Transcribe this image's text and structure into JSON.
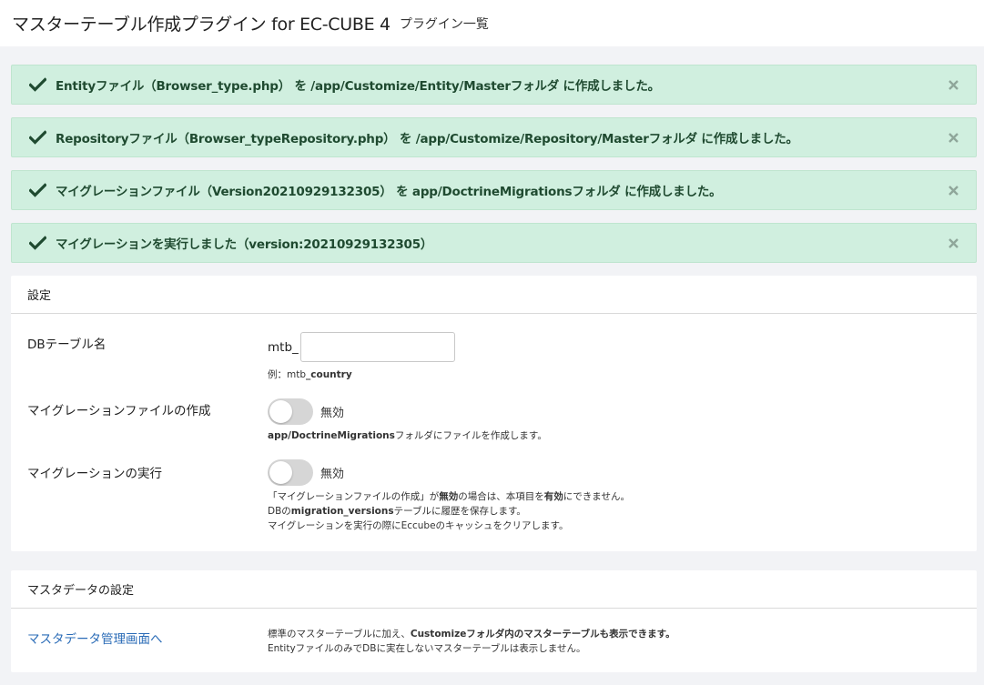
{
  "header": {
    "title": "マスターテーブル作成プラグイン for EC-CUBE 4",
    "subtitle": "プラグイン一覧"
  },
  "alerts": [
    {
      "message": "Entityファイル（Browser_type.php） を /app/Customize/Entity/Masterフォルダ に作成しました。"
    },
    {
      "message": "Repositoryファイル（Browser_typeRepository.php） を /app/Customize/Repository/Masterフォルダ に作成しました。"
    },
    {
      "message": "マイグレーションファイル（Version20210929132305） を app/DoctrineMigrationsフォルダ に作成しました。"
    },
    {
      "message": "マイグレーションを実行しました（version:20210929132305）"
    }
  ],
  "settings": {
    "title": "設定",
    "db_table": {
      "label": "DBテーブル名",
      "prefix": "mtb_",
      "value": "",
      "example_prefix": "例：mtb",
      "example_bold": "_country"
    },
    "migration_create": {
      "label": "マイグレーションファイルの作成",
      "state": "無効",
      "help_bold": "app/DoctrineMigrations",
      "help_rest": "フォルダにファイルを作成します。"
    },
    "migration_run": {
      "label": "マイグレーションの実行",
      "state": "無効",
      "help1_a": "「マイグレーションファイルの作成」が",
      "help1_b": "無効",
      "help1_c": "の場合は、本項目を",
      "help1_d": "有効",
      "help1_e": "にできません。",
      "help2_a": "DBの",
      "help2_b": "migration_versions",
      "help2_c": "テーブルに履歴を保存します。",
      "help3": "マイグレーションを実行の際にEccubeのキャッシュをクリアします。"
    }
  },
  "master": {
    "title": "マスタデータの設定",
    "link": "マスタデータ管理画面へ",
    "desc1_a": "標準のマスターテーブルに加え、",
    "desc1_b": "Customizeフォルダ内のマスターテーブルも表示できます。",
    "desc2": "EntityファイルのみでDBに実在しないマスターテーブルは表示しません。"
  },
  "colors": {
    "alert_bg": "#d0efdf",
    "alert_text": "#1f4a30",
    "link": "#2b6cb7",
    "toggle_off": "#d6d6d6"
  }
}
